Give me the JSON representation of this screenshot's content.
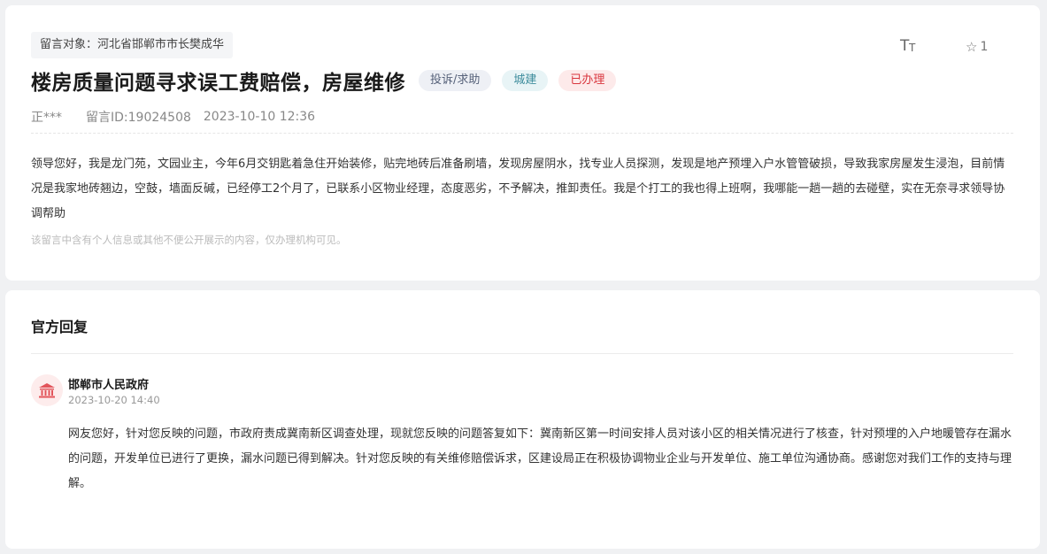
{
  "message": {
    "target_label": "留言对象：河北省邯郸市市长樊成华",
    "font_size_icon": "font-size-icon",
    "favorite": {
      "icon": "star-outline-icon",
      "count": "1"
    },
    "title": "楼房质量问题寻求误工费赔偿，房屋维修",
    "tags": {
      "type": "投诉/求助",
      "category": "城建",
      "status": "已办理"
    },
    "author": "正***",
    "message_id": "留言ID:19024508",
    "datetime": "2023-10-10 12:36",
    "content": "领导您好，我是龙门苑，文园业主，今年6月交钥匙着急住开始装修，贴完地砖后准备刷墙，发现房屋阴水，找专业人员探测，发现是地产预埋入户水管管破损，导致我家房屋发生浸泡，目前情况是我家地砖翘边，空鼓，墙面反碱，已经停工2个月了，已联系小区物业经理，态度恶劣，不予解决，推卸责任。我是个打工的我也得上班啊，我哪能一趟一趟的去碰壁，实在无奈寻求领导协调帮助",
    "privacy_note": "该留言中含有个人信息或其他不便公开展示的内容，仅办理机构可见。"
  },
  "reply": {
    "section_title": "官方回复",
    "department_icon": "government-building-icon",
    "department": "邯郸市人民政府",
    "datetime": "2023-10-20 14:40",
    "content": "网友您好，针对您反映的问题，市政府责成冀南新区调查处理，现就您反映的问题答复如下：冀南新区第一时间安排人员对该小区的相关情况进行了核查，针对预埋的入户地暖管存在漏水的问题，开发单位已进行了更换，漏水问题已得到解决。针对您反映的有关维修赔偿诉求，区建设局正在积极协调物业企业与开发单位、施工单位沟通协商。感谢您对我们工作的支持与理解。"
  },
  "colors": {
    "page_background": "#f0f1f3",
    "status_red": "#d9363e",
    "category_teal": "#3d8c9c",
    "avatar_icon_red": "#e2545a"
  }
}
